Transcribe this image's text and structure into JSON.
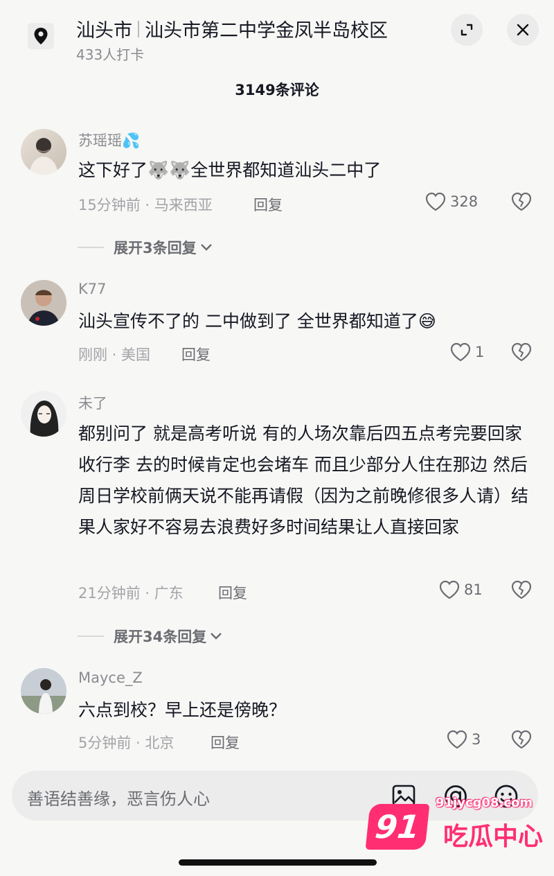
{
  "header": {
    "city": "汕头市",
    "location_name": "汕头市第二中学金凤半岛校区",
    "checkins": "433人打卡"
  },
  "comments_title": "3149条评论",
  "reply_label": "回复",
  "comments": [
    {
      "username": "苏瑶瑶💦",
      "text": "这下好了🐺🐺全世界都知道汕头二中了",
      "time": "15分钟前",
      "region": "马来西亚",
      "likes": "328",
      "expand": "展开3条回复"
    },
    {
      "username": "K77",
      "text": "汕头宣传不了的 二中做到了 全世界都知道了😅",
      "time": "刚刚",
      "region": "美国",
      "likes": "1"
    },
    {
      "username": "未了",
      "text": "都别问了 就是高考听说 有的人场次靠后四五点考完要回家收行李 去的时候肯定也会堵车 而且少部分人住在那边 然后周日学校前俩天说不能再请假（因为之前晚修很多人请）结果人家好不容易去浪费好多时间结果让人直接回家",
      "time": "21分钟前",
      "region": "广东",
      "likes": "81",
      "expand": "展开34条回复"
    },
    {
      "username": "Mayce_Z",
      "text": "六点到校？早上还是傍晚？",
      "time": "5分钟前",
      "region": "北京",
      "likes": "3"
    }
  ],
  "input": {
    "placeholder": "善语结善缘，恶言伤人心"
  },
  "watermark": {
    "badge": "91",
    "url": "91jycg08.com",
    "text": "吃瓜中心"
  },
  "icons": [
    "location-pin-icon",
    "expand-icon",
    "close-icon",
    "heart-icon",
    "broken-heart-icon",
    "chevron-down-icon",
    "image-icon",
    "at-icon",
    "emoji-icon"
  ],
  "colors": {
    "background": "#f7f7f5",
    "text": "#161823",
    "muted": "#8a8b91",
    "watermark": "#ff2e73"
  }
}
